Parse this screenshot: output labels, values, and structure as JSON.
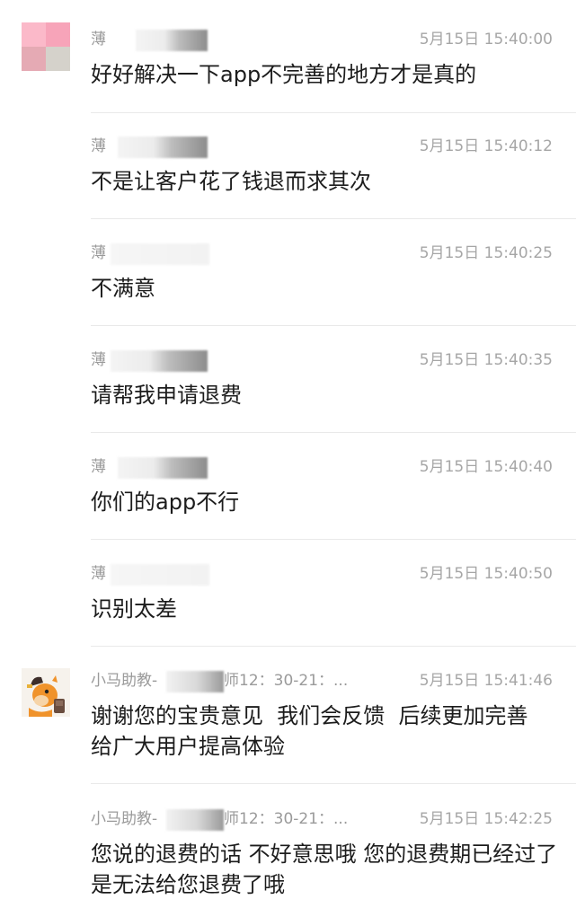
{
  "messages": [
    {
      "sender": "薄",
      "time": "5月15日 15:40:00",
      "text": "好好解决一下app不完善的地方才是真的"
    },
    {
      "sender": "薄",
      "time": "5月15日 15:40:12",
      "text": "不是让客户花了钱退而求其次"
    },
    {
      "sender": "薄",
      "time": "5月15日 15:40:25",
      "text": "不满意"
    },
    {
      "sender": "薄",
      "time": "5月15日 15:40:35",
      "text": "请帮我申请退费"
    },
    {
      "sender": "薄",
      "time": "5月15日 15:40:40",
      "text": "你们的app不行"
    },
    {
      "sender": "薄",
      "time": "5月15日 15:40:50",
      "text": "识别太差"
    },
    {
      "sender": "小马助教-",
      "sender_suffix": "师12：30-21：...",
      "time": "5月15日 15:41:46",
      "text": "谢谢您的宝贵意见  我们会反馈  后续更加完善  给广大用户提高体验"
    },
    {
      "sender": "小马助教-",
      "sender_suffix": "师12：30-21：...",
      "time": "5月15日 15:42:25",
      "text": "您说的退费的话 不好意思哦 您的退费期已经过了  是无法给您退费了哦"
    }
  ]
}
